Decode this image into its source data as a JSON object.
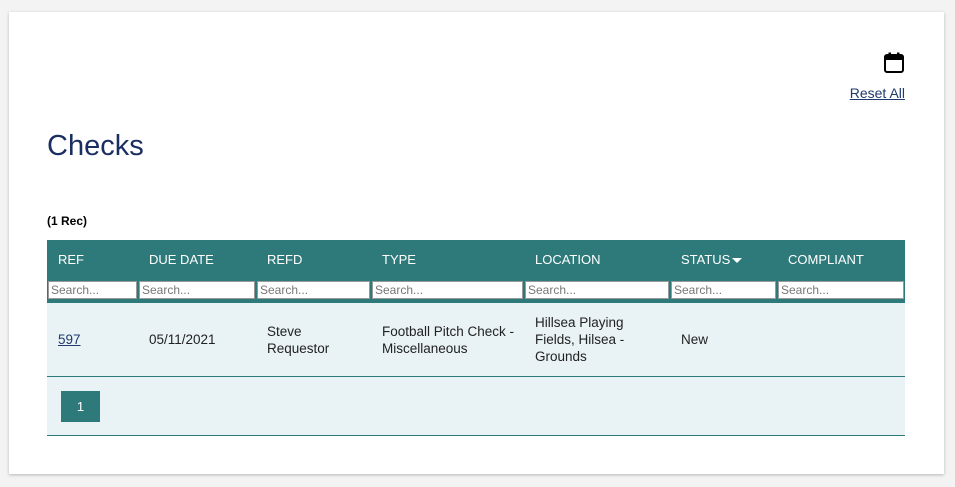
{
  "header": {
    "reset_label": "Reset All",
    "calendar_icon": "calendar-icon"
  },
  "page": {
    "title": "Checks",
    "record_count": "(1 Rec)"
  },
  "table": {
    "columns": [
      {
        "key": "ref",
        "label": "REF"
      },
      {
        "key": "due_date",
        "label": "DUE DATE"
      },
      {
        "key": "refd",
        "label": "REFD"
      },
      {
        "key": "type",
        "label": "TYPE"
      },
      {
        "key": "location",
        "label": "LOCATION"
      },
      {
        "key": "status",
        "label": "STATUS",
        "sorted": "desc"
      },
      {
        "key": "compliant",
        "label": "COMPLIANT"
      }
    ],
    "filter_placeholder": "Search...",
    "rows": [
      {
        "ref": "597",
        "due_date": "05/11/2021",
        "refd": "Steve Requestor",
        "type": "Football Pitch Check - Miscellaneous",
        "location": "Hillsea Playing Fields, Hilsea - Grounds",
        "status": "New",
        "compliant": ""
      }
    ]
  },
  "pager": {
    "current_page": "1"
  },
  "colors": {
    "header_bg": "#2e7a7b",
    "row_bg": "#e9f2f5",
    "title": "#1b2e62",
    "link": "#1f3a6e"
  }
}
